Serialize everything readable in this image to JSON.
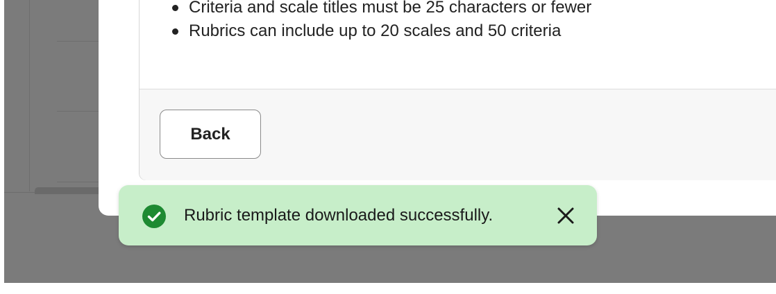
{
  "modal": {
    "rules": [
      "Criteria and scale titles must be 25 characters or fewer",
      "Rubrics can include up to 20 scales and 50 criteria"
    ],
    "back_label": "Back"
  },
  "toast": {
    "message": "Rubric template downloaded successfully.",
    "status_icon": "check-circle-icon",
    "close_icon": "close-icon",
    "colors": {
      "background": "#c7eec9",
      "icon": "#1e8a32"
    }
  },
  "colors": {
    "overlay": "#7b7b7b",
    "text": "#222222"
  }
}
